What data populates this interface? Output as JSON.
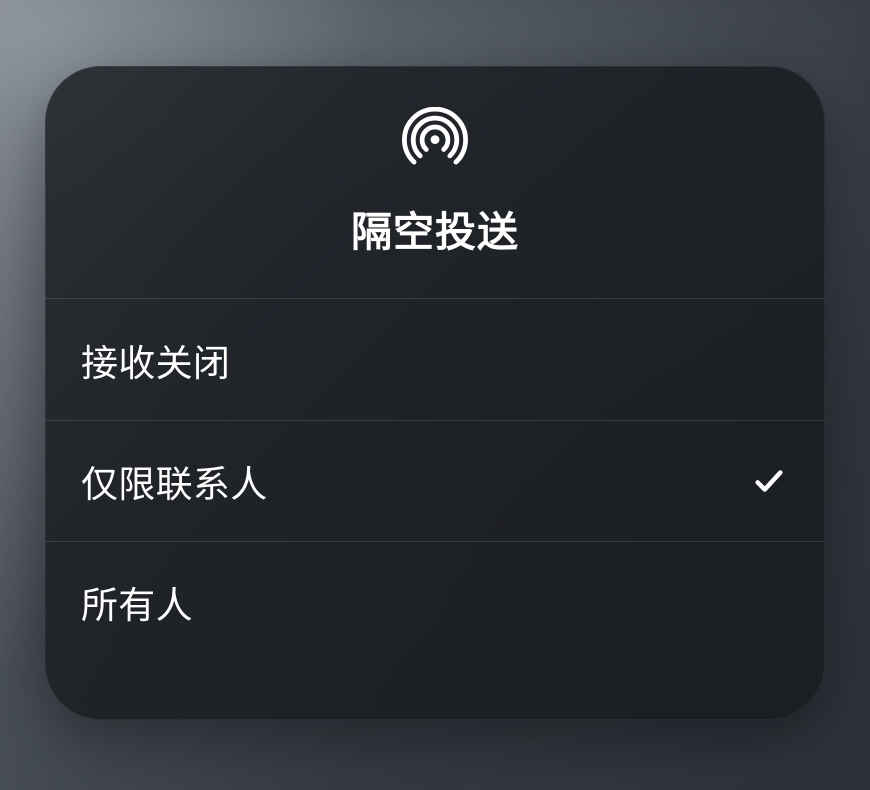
{
  "panel": {
    "title": "隔空投送",
    "icon_name": "airdrop-icon"
  },
  "options": [
    {
      "label": "接收关闭",
      "selected": false
    },
    {
      "label": "仅限联系人",
      "selected": true
    },
    {
      "label": "所有人",
      "selected": false
    }
  ]
}
